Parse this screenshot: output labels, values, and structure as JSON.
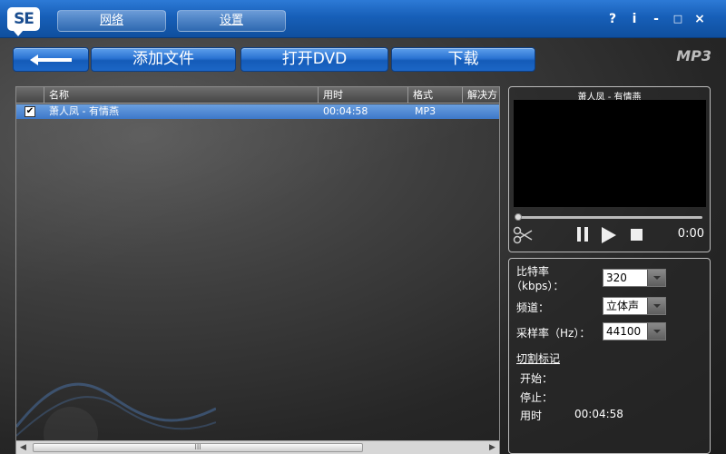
{
  "header": {
    "logo_text": "SE",
    "tabs": [
      {
        "label": "网络"
      },
      {
        "label": "设置"
      }
    ],
    "window_controls": {
      "help": "?",
      "info": "i",
      "minimize": "-",
      "maximize": "□",
      "close": "×"
    }
  },
  "toolbar": {
    "add_file_label": "添加文件",
    "open_dvd_label": "打开DVD",
    "download_label": "下载",
    "format": "MP3"
  },
  "file_list": {
    "columns": [
      "名称",
      "用时",
      "格式",
      "解决方"
    ],
    "rows": [
      {
        "checked": true,
        "name": "萧人凤 - 有情燕",
        "duration": "00:04:58",
        "format": "MP3",
        "resolution": ""
      }
    ],
    "scroll_thumb_grip": "III"
  },
  "preview": {
    "title": "萧人凤 - 有情燕",
    "time": "0:00"
  },
  "settings": {
    "bitrate_label_line1": "比特率",
    "bitrate_label_line2": "（kbps）：",
    "bitrate_value": "320",
    "channel_label": "频道：",
    "channel_value": "立体声",
    "samplerate_label": "采样率（Hz）：",
    "samplerate_value": "44100",
    "cut_marks_title": "切割标记",
    "start_label": "开始：",
    "start_value": "",
    "stop_label": "停止：",
    "stop_value": "",
    "duration_label": "用时",
    "duration_value": "00:04:58"
  },
  "colors": {
    "titlebar": "#175fb8",
    "button_blue": "#2a73d2",
    "selected_row": "#4f88d4"
  }
}
